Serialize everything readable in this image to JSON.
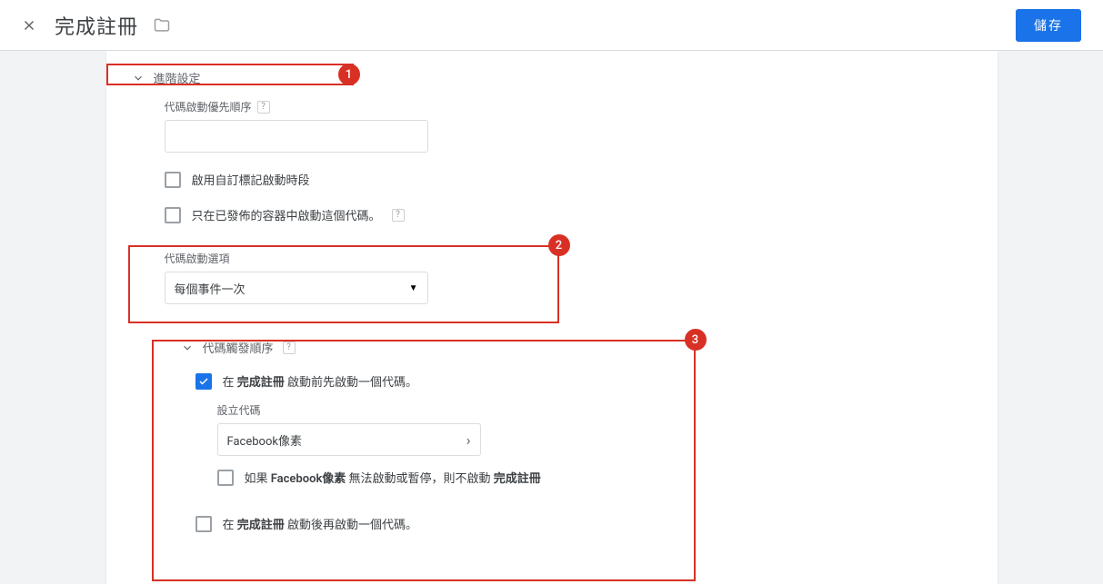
{
  "header": {
    "title": "完成註冊",
    "save_label": "儲存"
  },
  "advanced": {
    "section_title": "進階設定",
    "priority": {
      "label": "代碼啟動優先順序",
      "value": ""
    },
    "enable_custom_schedule": "啟用自訂標記啟動時段",
    "published_only": "只在已發佈的容器中啟動這個代碼。",
    "firing_options": {
      "label": "代碼啟動選項",
      "selected": "每個事件一次"
    },
    "sequencing": {
      "section_title": "代碼觸發順序",
      "fire_before_prefix": "在 ",
      "fire_before_bold": "完成註冊",
      "fire_before_suffix": " 啟動前先啟動一個代碼。",
      "setup_tag_label": "設立代碼",
      "setup_tag_value": "Facebook像素",
      "dont_fire_prefix": "如果 ",
      "dont_fire_bold1": "Facebook像素",
      "dont_fire_mid": " 無法啟動或暫停，則不啟動 ",
      "dont_fire_bold2": "完成註冊",
      "fire_after_prefix": "在 ",
      "fire_after_bold": "完成註冊",
      "fire_after_suffix": " 啟動後再啟動一個代碼。"
    }
  },
  "annotations": {
    "b1": "1",
    "b2": "2",
    "b3": "3"
  }
}
